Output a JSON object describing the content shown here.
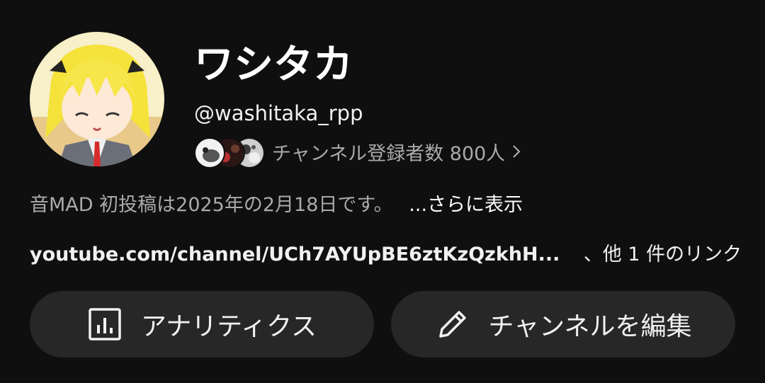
{
  "channel": {
    "name": "ワシタカ",
    "handle": "@washitaka_rpp",
    "subscribers_text": "チャンネル登録者数 800人",
    "description": "音MAD 初投稿は2025年の2月18日です。",
    "more_label": "...さらに表示",
    "link_url": "youtube.com/channel/UCh7AYUpBE6ztKzQzkhH...",
    "other_links": "、他 1 件のリンク"
  },
  "buttons": {
    "analytics_label": "アナリティクス",
    "edit_label": "チャンネルを編集"
  },
  "icons": {
    "subs_chevron": "chevron-right-icon",
    "analytics": "bar-chart-icon",
    "edit": "pencil-icon"
  },
  "colors": {
    "background": "#0f0f0f",
    "button_bg": "#272727",
    "secondary_text": "#aaaaaa",
    "primary_text": "#f1f1f1"
  }
}
